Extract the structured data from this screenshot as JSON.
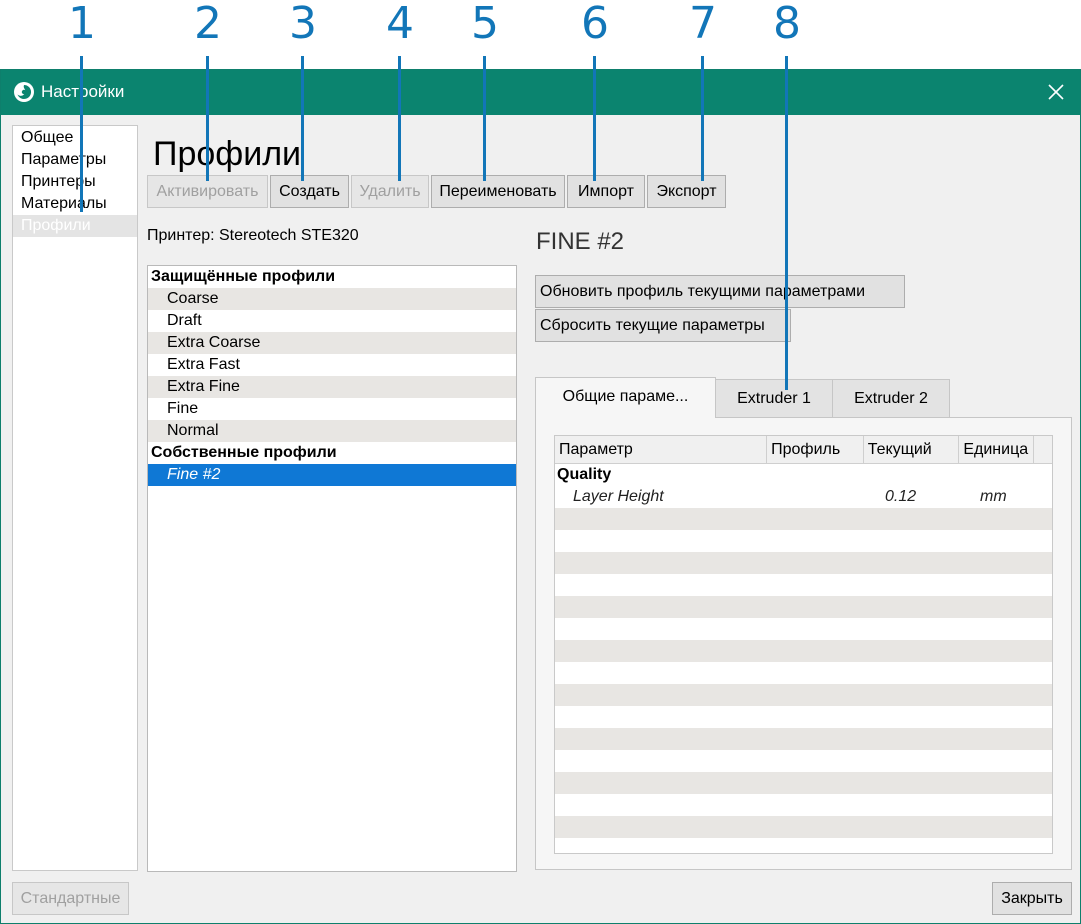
{
  "callouts": [
    "1",
    "2",
    "3",
    "4",
    "5",
    "6",
    "7",
    "8"
  ],
  "window": {
    "title": "Настройки"
  },
  "categories": [
    "Общее",
    "Параметры",
    "Принтеры",
    "Материалы",
    "Профили"
  ],
  "page_title": "Профили",
  "toolbar": {
    "activate": "Активировать",
    "create": "Создать",
    "delete": "Удалить",
    "rename": "Переименовать",
    "import": "Импорт",
    "export": "Экспорт"
  },
  "printer_label": "Принтер: Stereotech STE320",
  "profiles": {
    "protected_header": "Защищённые профили",
    "protected": [
      "Coarse",
      "Draft",
      "Extra Coarse",
      "Extra Fast",
      "Extra Fine",
      "Fine",
      "Normal"
    ],
    "custom_header": "Собственные профили",
    "custom": [
      "Fine #2"
    ]
  },
  "selected_profile_name": "FINE #2",
  "actions": {
    "update": "Обновить профиль текущими параметрами",
    "reset": "Сбросить текущие параметры"
  },
  "tabs": [
    "Общие параме...",
    "Extruder 1",
    "Extruder 2"
  ],
  "table": {
    "headers": [
      "Параметр",
      "Профиль",
      "Текущий",
      "Единица"
    ],
    "group": "Quality",
    "row": {
      "param": "Layer Height",
      "profile": "",
      "current": "0.12",
      "unit": "mm"
    }
  },
  "footer": {
    "defaults": "Стандартные",
    "close": "Закрыть"
  },
  "colors": {
    "titlebar": "#0b846f",
    "accent": "#1276b8",
    "selection": "#0f78d5"
  }
}
